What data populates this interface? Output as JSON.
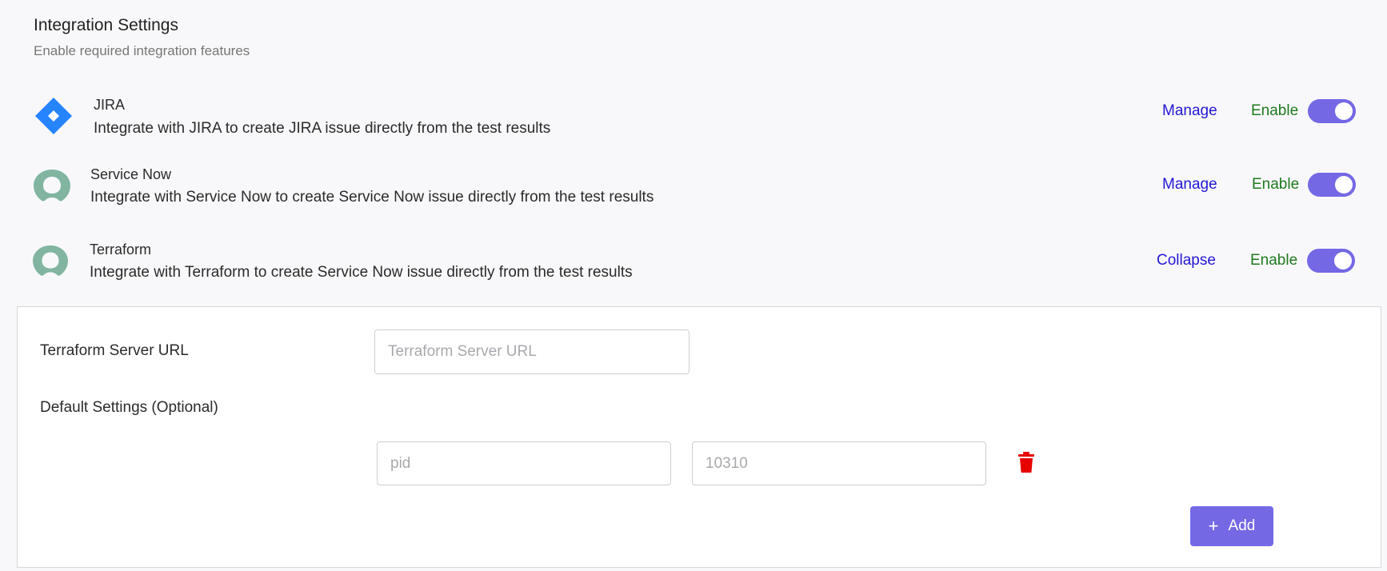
{
  "header": {
    "title": "Integration Settings",
    "subtitle": "Enable required integration features"
  },
  "integrations": [
    {
      "name": "JIRA",
      "description": "Integrate with JIRA to create JIRA issue directly from the test results",
      "action_label": "Manage",
      "enable_label": "Enable",
      "enabled": true,
      "icon": "jira-logo-icon"
    },
    {
      "name": "Service Now",
      "description": "Integrate with Service Now to create Service Now issue directly from the test results",
      "action_label": "Manage",
      "enable_label": "Enable",
      "enabled": true,
      "icon": "servicenow-logo-icon"
    },
    {
      "name": "Terraform",
      "description": "Integrate with Terraform to create Service Now issue directly from the test results",
      "action_label": "Collapse",
      "enable_label": "Enable",
      "enabled": true,
      "icon": "terraform-logo-icon"
    }
  ],
  "terraform_panel": {
    "server_url_label": "Terraform Server URL",
    "server_url_placeholder": "Terraform Server URL",
    "server_url_value": "",
    "default_settings_label": "Default Settings (Optional)",
    "setting_key_placeholder": "pid",
    "setting_value_placeholder": "10310",
    "add_label": "Add",
    "add_icon": "plus-icon",
    "delete_icon": "trash-icon"
  },
  "colors": {
    "accent": "#7468e5",
    "link": "#2317d4",
    "enable_text": "#1f7a1f",
    "delete": "#e60000",
    "jira": "#2684ff",
    "servicenow": "#81b5a1"
  }
}
